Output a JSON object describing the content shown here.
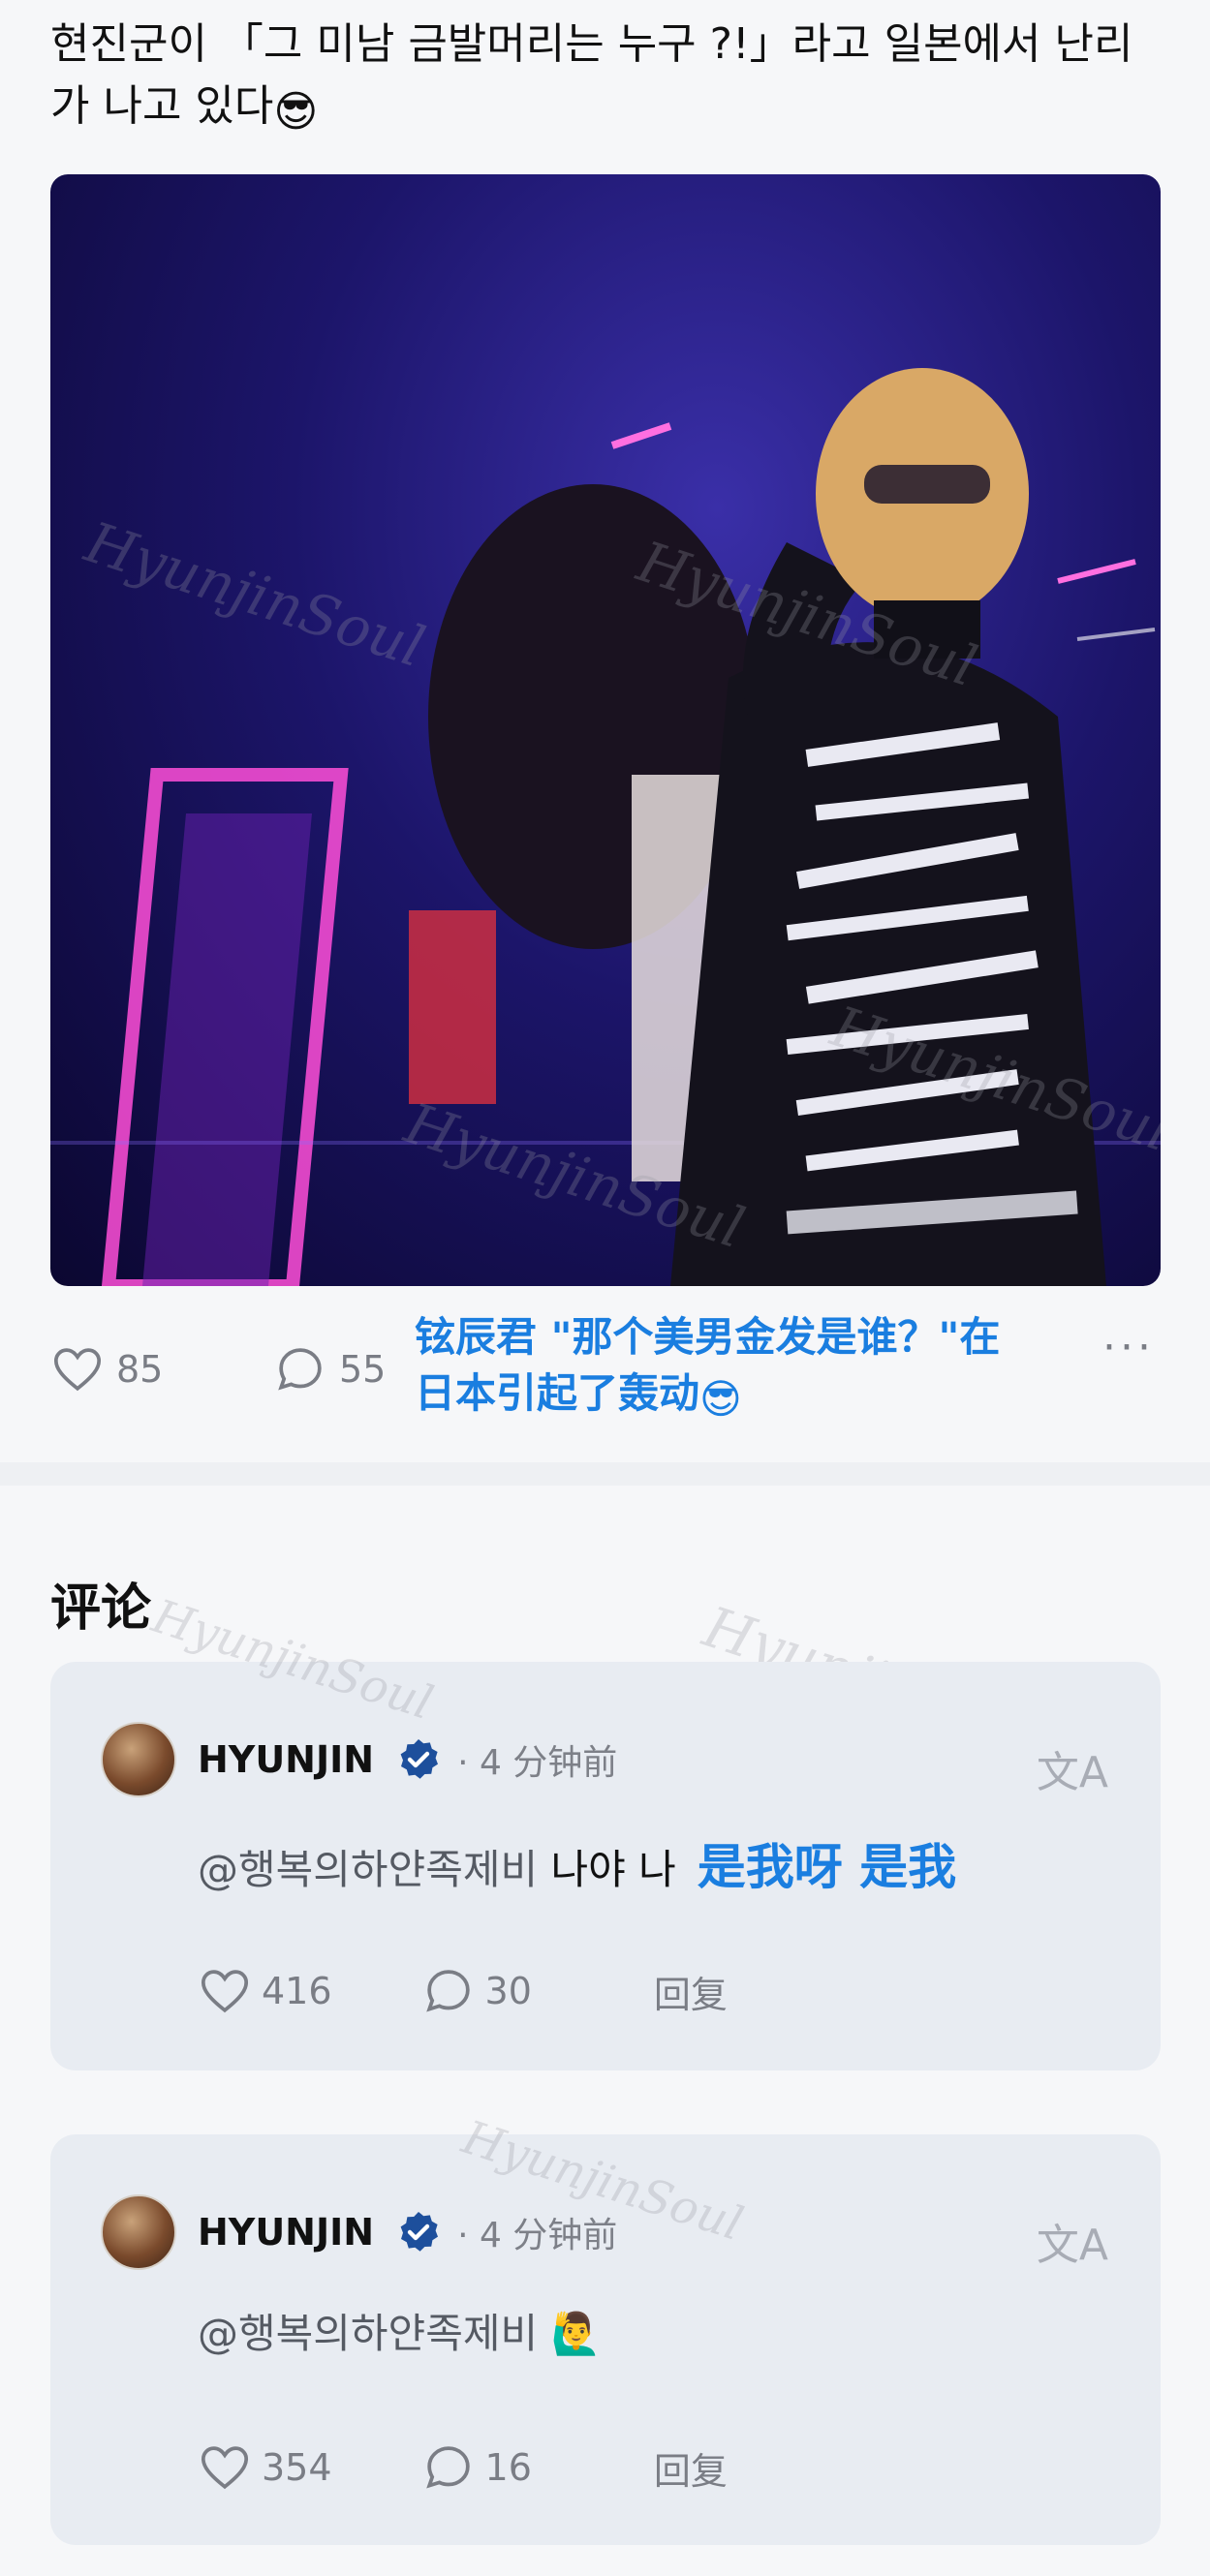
{
  "post": {
    "text": "현진군이 「그 미남 금발머리는 누구 ?!」라고 일본에서 난리가 나고 있다",
    "emoji": "😎",
    "likes": "85",
    "comments": "55",
    "caption": "铉辰君 \"那个美男金发是谁？\"在日本引起了轰动",
    "caption_emoji": "😎",
    "more": "···"
  },
  "comments_section": {
    "title": "评论",
    "items": [
      {
        "username": "HYUNJIN",
        "time": "· 4 分钟前",
        "mention": "@행복의하얀족제비",
        "text": " 나야 나",
        "translation": "是我呀 是我",
        "likes": "416",
        "replies": "30",
        "reply_label": "回复",
        "translate_icon": "文A"
      },
      {
        "username": "HYUNJIN",
        "time": "· 4 分钟前",
        "mention": "@행복의하얀족제비",
        "text": " 🙋‍♂️",
        "translation": "",
        "likes": "354",
        "replies": "16",
        "reply_label": "回复",
        "translate_icon": "文A"
      }
    ]
  },
  "watermark": "HyunjinSoul",
  "colors": {
    "accent": "#1a7ee0",
    "verified": "#1d4f9c",
    "card": "#e8ecf2"
  }
}
